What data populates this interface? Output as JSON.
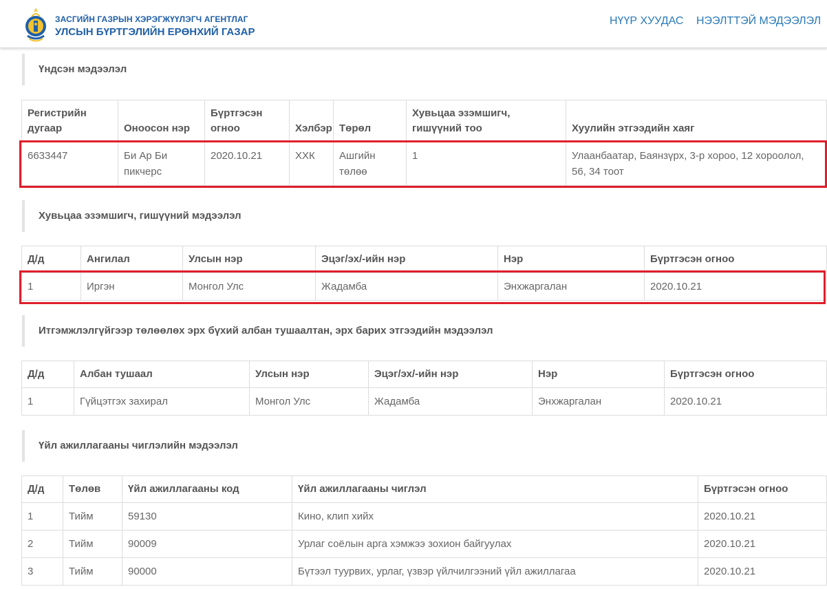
{
  "header": {
    "org_line1": "ЗАСГИЙН ГАЗРЫН ХЭРЭГЖҮҮЛЭГЧ АГЕНТЛАГ",
    "org_line2": "УЛСЫН БҮРТГЭЛИЙН ЕРӨНХИЙ ГАЗАР",
    "nav": [
      "НҮҮР ХУУДАС",
      "НЭЭЛТТЭЙ МЭДЭЭЛЭЛ"
    ]
  },
  "colors": {
    "accent": "#2a7ab8",
    "highlight": "#e01e2b"
  },
  "sections": {
    "basic": {
      "title": "Үндсэн мэдээлэл",
      "headers": [
        "Регистрийн дугаар",
        "Оноосон нэр",
        "Бүртгэсэн огноо",
        "Хэлбэр",
        "Төрөл",
        "Хувьцаа эзэмшигч, гишүүний тоо",
        "Хуулийн этгээдийн хаяг"
      ],
      "rows": [
        [
          "6633447",
          "Би Ар Би пикчерс",
          "2020.10.21",
          "ХХК",
          "Ашгийн төлөө",
          "1",
          "Улаанбаатар, Баянзүрх, 3-р хороо, 12 хороолол, 56, 34 тоот"
        ]
      ]
    },
    "shareholders": {
      "title": "Хувьцаа эзэмшигч, гишүүний мэдээлэл",
      "headers": [
        "Д/д",
        "Ангилал",
        "Улсын нэр",
        "Эцэг/эх/-ийн нэр",
        "Нэр",
        "Бүртгэсэн огноо"
      ],
      "rows": [
        [
          "1",
          "Иргэн",
          "Монгол Улс",
          "Жадамба",
          "Энхжаргалан",
          "2020.10.21"
        ]
      ]
    },
    "officials": {
      "title": "Итгэмжлэлгүйгээр төлөөлөх эрх бүхий албан тушаалтан, эрх барих этгээдийн мэдээлэл",
      "headers": [
        "Д/д",
        "Албан тушаал",
        "Улсын нэр",
        "Эцэг/эх/-ийн нэр",
        "Нэр",
        "Бүртгэсэн огноо"
      ],
      "rows": [
        [
          "1",
          "Гүйцэтгэх захирал",
          "Монгол Улс",
          "Жадамба",
          "Энхжаргалан",
          "2020.10.21"
        ]
      ]
    },
    "activities": {
      "title": "Үйл ажиллагааны чиглэлийн мэдээлэл",
      "headers": [
        "Д/д",
        "Төлөв",
        "Үйл ажиллагааны код",
        "Үйл ажиллагааны чиглэл",
        "Бүртгэсэн огноо"
      ],
      "rows": [
        [
          "1",
          "Тийм",
          "59130",
          "Кино, клип хийх",
          "2020.10.21"
        ],
        [
          "2",
          "Тийм",
          "90009",
          "Урлаг соёлын арга хэмжээ зохион байгуулах",
          "2020.10.21"
        ],
        [
          "3",
          "Тийм",
          "90000",
          "Бүтээл туурвих, урлаг, үзвэр үйлчилгээний үйл ажиллагаа",
          "2020.10.21"
        ]
      ]
    }
  }
}
